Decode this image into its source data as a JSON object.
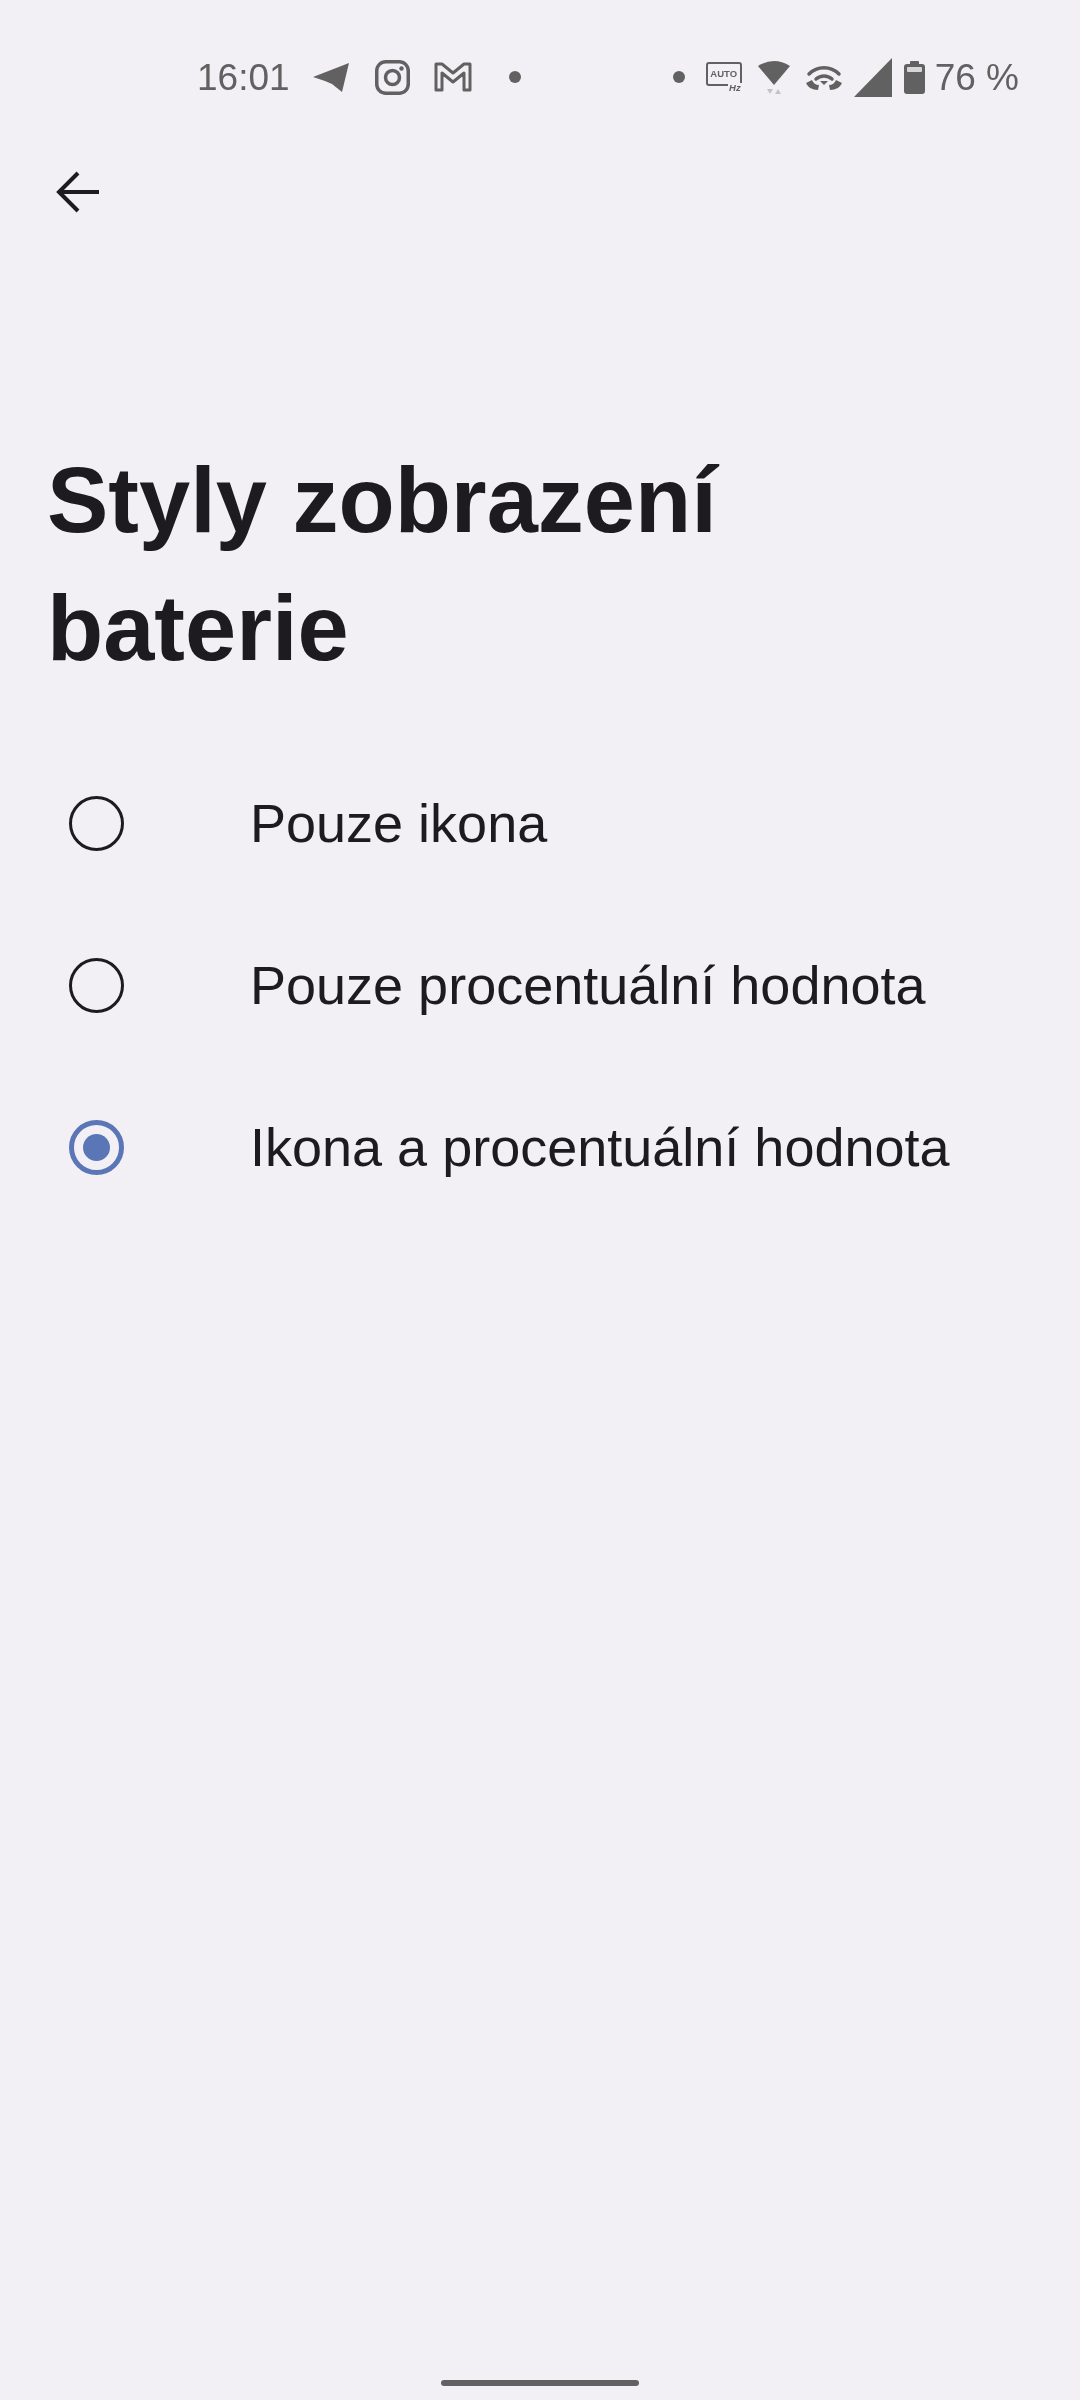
{
  "status_bar": {
    "time": "16:01",
    "refresh_rate_badge": {
      "label": "AUTO",
      "unit": "Hz"
    },
    "battery": "76 %"
  },
  "title": "Styly zobrazení baterie",
  "options": [
    {
      "label": "Pouze ikona",
      "selected": false
    },
    {
      "label": "Pouze procentuální hodnota",
      "selected": false
    },
    {
      "label": "Ikona a procentuální hodnota",
      "selected": true
    }
  ]
}
